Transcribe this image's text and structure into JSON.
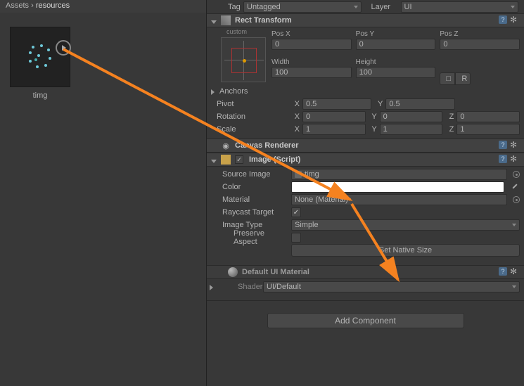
{
  "breadcrumb": {
    "assets": "Assets",
    "sep": "›",
    "folder": "resources"
  },
  "asset": {
    "name": "timg"
  },
  "tag": {
    "label": "Tag",
    "value": "Untagged"
  },
  "layer": {
    "label": "Layer",
    "value": "UI"
  },
  "rect_transform": {
    "title": "Rect Transform",
    "anchor_preset": "custom",
    "pos_x_label": "Pos X",
    "pos_y_label": "Pos Y",
    "pos_z_label": "Pos Z",
    "pos_x": "0",
    "pos_y": "0",
    "pos_z": "0",
    "width_label": "Width",
    "height_label": "Height",
    "width": "100",
    "height": "100",
    "r_btn": "R",
    "anchors_label": "Anchors",
    "pivot_label": "Pivot",
    "pivot_x": "0.5",
    "pivot_y": "0.5",
    "rotation_label": "Rotation",
    "rot_x": "0",
    "rot_y": "0",
    "rot_z": "0",
    "scale_label": "Scale",
    "scale_x": "1",
    "scale_y": "1",
    "scale_z": "1"
  },
  "canvas_renderer": {
    "title": "Canvas Renderer"
  },
  "image": {
    "title": "Image (Script)",
    "source_label": "Source Image",
    "source_value": "timg",
    "color_label": "Color",
    "material_label": "Material",
    "material_value": "None (Material)",
    "raycast_label": "Raycast Target",
    "type_label": "Image Type",
    "type_value": "Simple",
    "preserve_label": "Preserve Aspect",
    "set_native": "Set Native Size"
  },
  "material": {
    "title": "Default UI Material",
    "shader_label": "Shader",
    "shader_value": "UI/Default"
  },
  "add_component": "Add Component",
  "xyz": {
    "x": "X",
    "y": "Y",
    "z": "Z"
  }
}
